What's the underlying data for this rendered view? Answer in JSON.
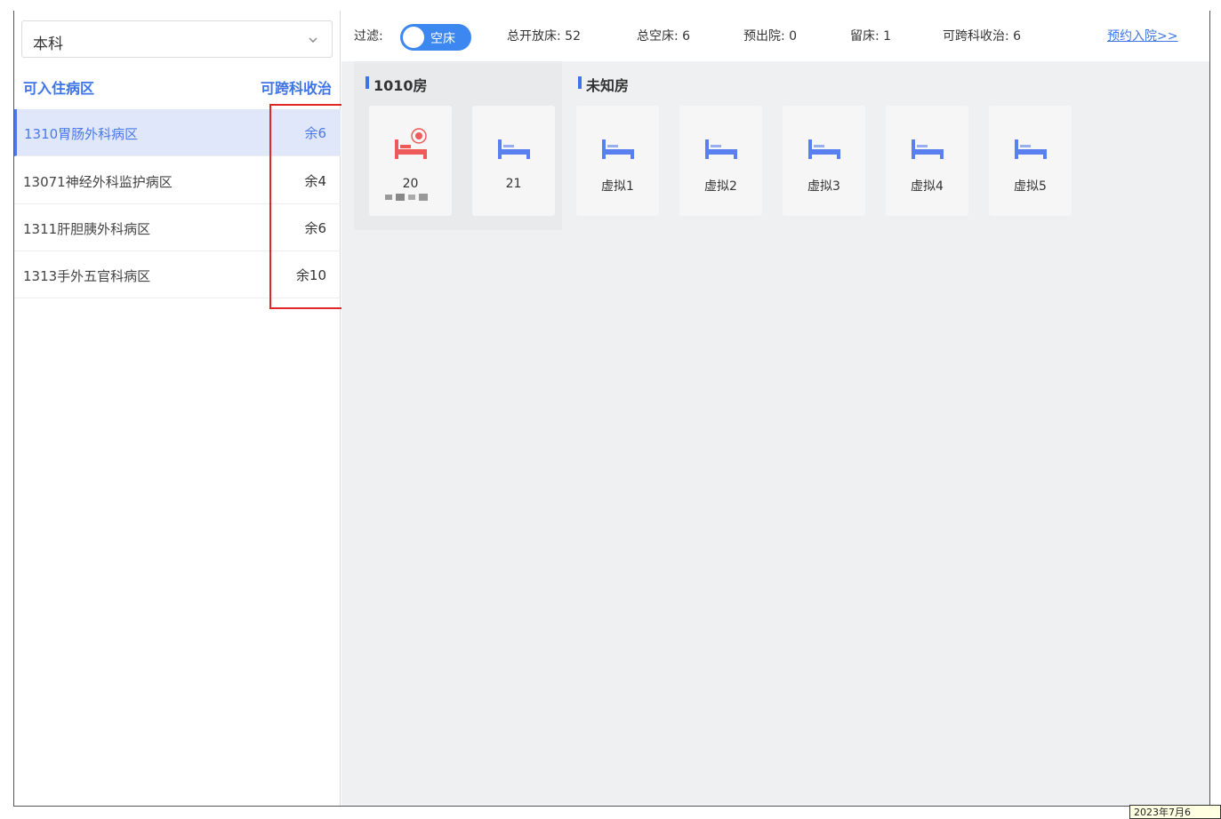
{
  "sidebar": {
    "select": {
      "value": "本科"
    },
    "header": {
      "left": "可入住病区",
      "right": "可跨科收治"
    },
    "wards": [
      {
        "name": "1310胃肠外科病区",
        "count": "余6",
        "active": true
      },
      {
        "name": "13071神经外科监护病区",
        "count": "余4",
        "active": false
      },
      {
        "name": "1311肝胆胰外科病区",
        "count": "余6",
        "active": false
      },
      {
        "name": "1313手外五官科病区",
        "count": "余10",
        "active": false
      }
    ]
  },
  "toolbar": {
    "filter_label": "过滤:",
    "toggle_label": "空床",
    "stats": [
      "总开放床: 52",
      "总空床: 6",
      "预出院: 0",
      "留床: 1",
      "可跨科收治: 6"
    ],
    "link": "预约入院>>"
  },
  "rooms": [
    {
      "title": "1010房",
      "beds": [
        {
          "label": "20",
          "status": "occupied",
          "color": "#ef5a5a"
        },
        {
          "label": "21",
          "status": "empty",
          "color": "#5a7fee"
        }
      ]
    },
    {
      "title": "未知房",
      "beds": [
        {
          "label": "虚拟1",
          "status": "empty",
          "color": "#5a7fee"
        },
        {
          "label": "虚拟2",
          "status": "empty",
          "color": "#5a7fee"
        },
        {
          "label": "虚拟3",
          "status": "empty",
          "color": "#5a7fee"
        },
        {
          "label": "虚拟4",
          "status": "empty",
          "color": "#5a7fee"
        },
        {
          "label": "虚拟5",
          "status": "empty",
          "color": "#5a7fee"
        }
      ]
    }
  ],
  "tooltip": "2023年7月6"
}
